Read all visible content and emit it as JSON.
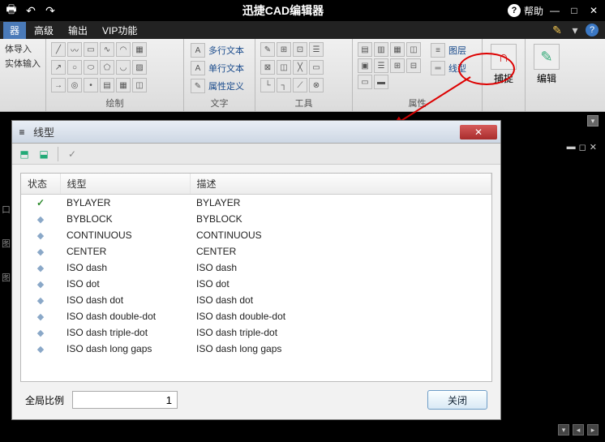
{
  "titlebar": {
    "app_title": "迅捷CAD编辑器",
    "help_label": "帮助"
  },
  "menu": {
    "items": [
      "器",
      "高级",
      "输出",
      "VIP功能"
    ]
  },
  "ribbon": {
    "group0": {
      "label": "",
      "row0": "体导入",
      "row1": "实体输入"
    },
    "group_draw": {
      "label": "绘制"
    },
    "group_text": {
      "label": "文字",
      "multi": "多行文本",
      "single": "单行文本",
      "attr": "属性定义"
    },
    "group_tools": {
      "label": "工具"
    },
    "group_props": {
      "label": "属性",
      "layer": "图层",
      "linetype": "线型"
    },
    "group_snap": {
      "label": "捕捉"
    },
    "group_edit": {
      "label": "编辑"
    }
  },
  "dialog": {
    "title": "线型",
    "columns": {
      "state": "状态",
      "linetype": "线型",
      "desc": "描述"
    },
    "rows": [
      {
        "state": "check",
        "name": "BYLAYER",
        "desc": "BYLAYER"
      },
      {
        "state": "diamond",
        "name": "BYBLOCK",
        "desc": "BYBLOCK"
      },
      {
        "state": "diamond",
        "name": "CONTINUOUS",
        "desc": "CONTINUOUS"
      },
      {
        "state": "diamond",
        "name": "CENTER",
        "desc": "CENTER"
      },
      {
        "state": "diamond",
        "name": "ISO dash",
        "desc": "ISO dash"
      },
      {
        "state": "diamond",
        "name": "ISO dot",
        "desc": "ISO dot"
      },
      {
        "state": "diamond",
        "name": "ISO dash dot",
        "desc": "ISO dash dot"
      },
      {
        "state": "diamond",
        "name": "ISO dash double-dot",
        "desc": "ISO dash double-dot"
      },
      {
        "state": "diamond",
        "name": "ISO dash triple-dot",
        "desc": "ISO dash triple-dot"
      },
      {
        "state": "diamond",
        "name": "ISO dash long gaps",
        "desc": "ISO dash long gaps"
      }
    ],
    "scale_label": "全局比例",
    "scale_value": "1",
    "close_label": "关闭"
  }
}
